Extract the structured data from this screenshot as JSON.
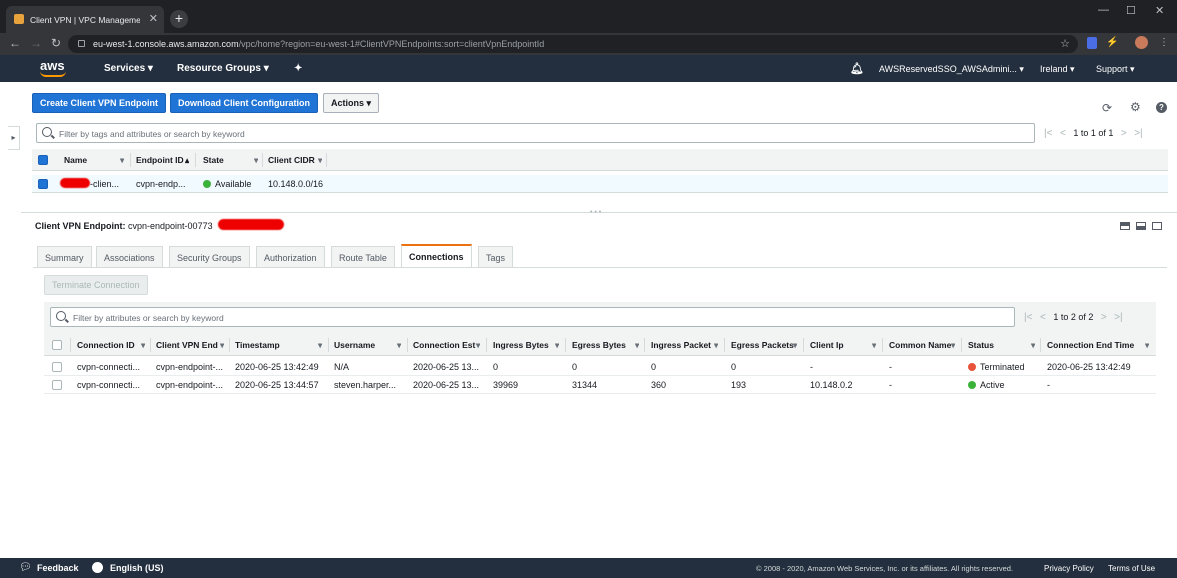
{
  "browser": {
    "tab_title": "Client VPN | VPC Management C",
    "url_domain": "eu-west-1.console.aws.amazon.com",
    "url_path": "/vpc/home?region=eu-west-1#ClientVPNEndpoints:sort=clientVpnEndpointId"
  },
  "aws_nav": {
    "logo": "aws",
    "services": "Services",
    "resource_groups": "Resource Groups",
    "account": "AWSReservedSSO_AWSAdmini...",
    "region": "Ireland",
    "support": "Support"
  },
  "toolbar": {
    "create_label": "Create Client VPN Endpoint",
    "download_label": "Download Client Configuration",
    "actions_label": "Actions"
  },
  "endpoints": {
    "search_placeholder": "Filter by tags and attributes or search by keyword",
    "pager_text": "1 to 1 of 1",
    "columns": [
      "Name",
      "Endpoint ID",
      "State",
      "Client CIDR"
    ],
    "rows": [
      {
        "name": "-clien...",
        "endpoint_id": "cvpn-endp...",
        "state": "Available",
        "cidr": "10.148.0.0/16"
      }
    ]
  },
  "details": {
    "label": "Client VPN Endpoint:",
    "endpoint_id": "cvpn-endpoint-00773",
    "tabs": [
      "Summary",
      "Associations",
      "Security Groups",
      "Authorization",
      "Route Table",
      "Connections",
      "Tags"
    ],
    "active_tab": "Connections",
    "terminate_label": "Terminate Connection",
    "search_placeholder": "Filter by attributes or search by keyword",
    "pager_text": "1 to 2 of 2",
    "columns": [
      "Connection ID",
      "Client VPN End",
      "Timestamp",
      "Username",
      "Connection Est",
      "Ingress Bytes",
      "Egress Bytes",
      "Ingress Packet",
      "Egress Packets",
      "Client Ip",
      "Common Name",
      "Status",
      "Connection End Time"
    ],
    "rows": [
      {
        "connection_id": "cvpn-connecti...",
        "endpoint": "cvpn-endpoint-...",
        "timestamp": "2020-06-25 13:42:49",
        "username": "N/A",
        "established": "2020-06-25 13...",
        "ingress_bytes": "0",
        "egress_bytes": "0",
        "ingress_packets": "0",
        "egress_packets": "0",
        "client_ip": "-",
        "common_name": "-",
        "status": "Terminated",
        "end_time": "2020-06-25 13:42:49"
      },
      {
        "connection_id": "cvpn-connecti...",
        "endpoint": "cvpn-endpoint-...",
        "timestamp": "2020-06-25 13:44:57",
        "username": "steven.harper...",
        "established": "2020-06-25 13...",
        "ingress_bytes": "39969",
        "egress_bytes": "31344",
        "ingress_packets": "360",
        "egress_packets": "193",
        "client_ip": "10.148.0.2",
        "common_name": "-",
        "status": "Active",
        "end_time": "-"
      }
    ]
  },
  "footer": {
    "feedback": "Feedback",
    "language": "English (US)",
    "copyright": "© 2008 - 2020, Amazon Web Services, Inc. or its affiliates. All rights reserved.",
    "privacy": "Privacy Policy",
    "terms": "Terms of Use"
  },
  "colors": {
    "aws_nav": "#232f3e",
    "primary_button": "#2074d5",
    "available_green": "#1d8102",
    "terminated_red": "#d13212",
    "tab_accent": "#ec7211"
  }
}
